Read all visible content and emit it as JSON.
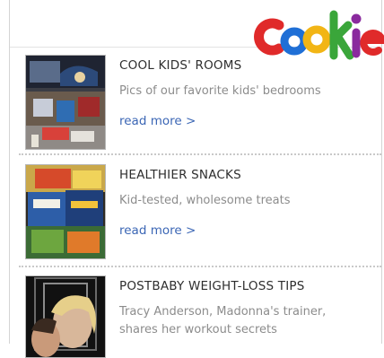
{
  "brand": {
    "logo_text": "Cookie",
    "logo_colors": [
      "#e02a2a",
      "#1f6fd6",
      "#f2b515",
      "#3aa63a",
      "#8a2a9e",
      "#e02a2a"
    ]
  },
  "articles": [
    {
      "title": "COOL KIDS' ROOMS",
      "description": "Pics of our favorite kids' bedrooms",
      "link": "read more >"
    },
    {
      "title": "HEALTHIER SNACKS",
      "description": "Kid-tested, wholesome treats",
      "link": "read more >"
    },
    {
      "title": "POSTBABY WEIGHT-LOSS TIPS",
      "description": "Tracy Anderson, Madonna's trainer, shares her workout secrets"
    }
  ],
  "colors": {
    "link": "#3b66b5",
    "title": "#2e2e2e",
    "description": "#8c8c8c"
  }
}
